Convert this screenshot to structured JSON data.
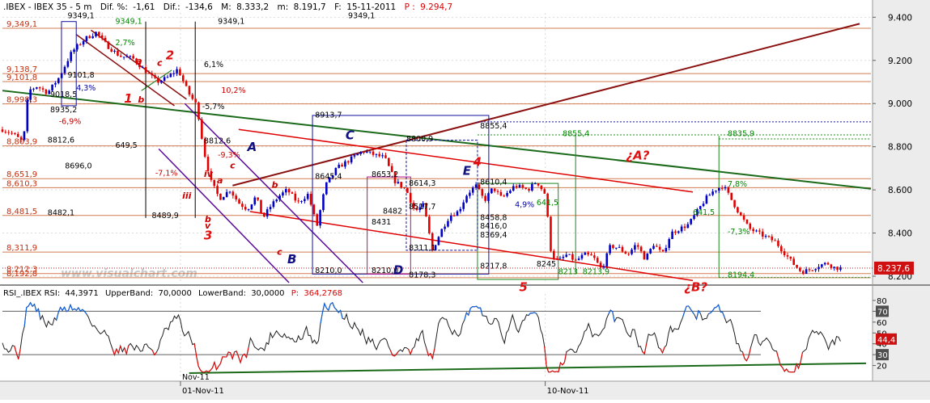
{
  "header": {
    "symbol": ".IBEX - IBEX 35 - 5 m",
    "dif_pct_label": "Dif. %:",
    "dif_pct": "-1,61",
    "dif_label": "Dif.:",
    "dif": "-134,6",
    "max_label": "M:",
    "max": "8.333,2",
    "min_label": "m:",
    "min": "8.191,7",
    "date_label": "F:",
    "date": "15-11-2011",
    "price_label": "P :",
    "price": "9.294,7"
  },
  "watermark": "www.visualchart.com",
  "colors": {
    "up": "#0000c8",
    "down": "#e00000",
    "wave": "#e01010",
    "wave_blue": "#101080",
    "fib": "#cc6633",
    "trend_main": "#1a6a1a",
    "trend_up": "#8b1010",
    "channel": "#5a0a9a",
    "rsi_line": "#202020",
    "rsi_level": "#606060",
    "price_badge": "#d01010"
  },
  "rsi_header": {
    "label": "RSI_.IBEX RSI:",
    "value": "44,3971",
    "upper_label": "UpperBand:",
    "upper": "70,0000",
    "lower_label": "LowerBand:",
    "lower": "30,0000",
    "p_label": "P:",
    "p": "364,2768"
  },
  "chart_data": [
    {
      "type": "candlestick",
      "series": [
        {
          "name": "IBEX 35 - 5 m"
        }
      ],
      "ylim": [
        8170,
        9420
      ],
      "y_ticks": [
        8200,
        8400,
        8600,
        8800,
        9000,
        9200,
        9400
      ],
      "y_tick_labels": [
        "8.200",
        "8.400",
        "8.600",
        "8.800",
        "9.000",
        "9.200",
        "9.400"
      ],
      "x_labels": [
        {
          "label": "01-Nov-11",
          "pos": 0.205
        },
        {
          "label": "10-Nov-11",
          "pos": 0.625
        }
      ],
      "last_price": 8237.6,
      "last_price_label": "8.237,6",
      "path": [
        [
          0.0,
          8880
        ],
        [
          0.012,
          8860
        ],
        [
          0.024,
          8820
        ],
        [
          0.03,
          9060
        ],
        [
          0.04,
          9080
        ],
        [
          0.052,
          9050
        ],
        [
          0.065,
          9120
        ],
        [
          0.08,
          9240
        ],
        [
          0.095,
          9300
        ],
        [
          0.108,
          9330
        ],
        [
          0.12,
          9270
        ],
        [
          0.135,
          9220
        ],
        [
          0.15,
          9210
        ],
        [
          0.165,
          9150
        ],
        [
          0.178,
          9100
        ],
        [
          0.19,
          9120
        ],
        [
          0.202,
          9160
        ],
        [
          0.214,
          9050
        ],
        [
          0.224,
          8990
        ],
        [
          0.232,
          8780
        ],
        [
          0.24,
          8640
        ],
        [
          0.25,
          8560
        ],
        [
          0.262,
          8600
        ],
        [
          0.272,
          8540
        ],
        [
          0.282,
          8510
        ],
        [
          0.292,
          8570
        ],
        [
          0.3,
          8470
        ],
        [
          0.308,
          8520
        ],
        [
          0.318,
          8570
        ],
        [
          0.328,
          8600
        ],
        [
          0.34,
          8540
        ],
        [
          0.352,
          8580
        ],
        [
          0.362,
          8430
        ],
        [
          0.372,
          8620
        ],
        [
          0.385,
          8700
        ],
        [
          0.4,
          8740
        ],
        [
          0.415,
          8780
        ],
        [
          0.43,
          8760
        ],
        [
          0.44,
          8750
        ],
        [
          0.452,
          8640
        ],
        [
          0.465,
          8600
        ],
        [
          0.475,
          8500
        ],
        [
          0.485,
          8530
        ],
        [
          0.495,
          8320
        ],
        [
          0.505,
          8410
        ],
        [
          0.515,
          8480
        ],
        [
          0.525,
          8500
        ],
        [
          0.535,
          8580
        ],
        [
          0.545,
          8620
        ],
        [
          0.555,
          8550
        ],
        [
          0.565,
          8610
        ],
        [
          0.575,
          8560
        ],
        [
          0.59,
          8620
        ],
        [
          0.605,
          8600
        ],
        [
          0.615,
          8640
        ],
        [
          0.625,
          8580
        ],
        [
          0.632,
          8300
        ],
        [
          0.64,
          8270
        ],
        [
          0.65,
          8300
        ],
        [
          0.66,
          8270
        ],
        [
          0.67,
          8300
        ],
        [
          0.68,
          8290
        ],
        [
          0.69,
          8230
        ],
        [
          0.7,
          8340
        ],
        [
          0.71,
          8330
        ],
        [
          0.72,
          8300
        ],
        [
          0.73,
          8350
        ],
        [
          0.74,
          8280
        ],
        [
          0.75,
          8350
        ],
        [
          0.76,
          8300
        ],
        [
          0.77,
          8400
        ],
        [
          0.78,
          8420
        ],
        [
          0.79,
          8440
        ],
        [
          0.8,
          8500
        ],
        [
          0.81,
          8560
        ],
        [
          0.82,
          8600
        ],
        [
          0.83,
          8620
        ],
        [
          0.84,
          8550
        ],
        [
          0.85,
          8480
        ],
        [
          0.86,
          8420
        ],
        [
          0.87,
          8400
        ],
        [
          0.88,
          8380
        ],
        [
          0.89,
          8360
        ],
        [
          0.9,
          8310
        ],
        [
          0.91,
          8260
        ],
        [
          0.92,
          8220
        ],
        [
          0.93,
          8230
        ],
        [
          0.94,
          8250
        ],
        [
          0.95,
          8260
        ],
        [
          0.958,
          8240
        ],
        [
          0.965,
          8237.6
        ]
      ],
      "levels": [
        {
          "label": "9,349,1",
          "value": 9349.1
        },
        {
          "label": "9,138,7",
          "value": 9138.7
        },
        {
          "label": "9,101,8",
          "value": 9101.8
        },
        {
          "label": "8,998,3",
          "value": 8998.3
        },
        {
          "label": "8,803,9",
          "value": 8803.9
        },
        {
          "label": "8,651,9",
          "value": 8651.9
        },
        {
          "label": "8,610,3",
          "value": 8610.3
        },
        {
          "label": "8,481,5",
          "value": 8481.5
        },
        {
          "label": "8,311,9",
          "value": 8311.9
        },
        {
          "label": "8,212,3",
          "value": 8212.3
        },
        {
          "label": "8,192,8",
          "value": 8192.8
        }
      ],
      "annotations": [
        {
          "text": "9349,1",
          "pos": 0.075,
          "value": 9395,
          "color": "#000000"
        },
        {
          "text": "9349,1",
          "pos": 0.398,
          "value": 9395,
          "color": "#000000"
        },
        {
          "text": "9349,1",
          "pos": 0.248,
          "value": 9370,
          "color": "#000000"
        },
        {
          "text": "9349,1",
          "pos": 0.13,
          "value": 9370,
          "color": "#008800"
        },
        {
          "text": "2,7%",
          "pos": 0.13,
          "value": 9270,
          "color": "#008800"
        },
        {
          "text": "9101,8",
          "pos": 0.075,
          "value": 9120,
          "color": "#000000"
        },
        {
          "text": "9018,5",
          "pos": 0.055,
          "value": 9030,
          "color": "#000000"
        },
        {
          "text": "4,3%",
          "pos": 0.085,
          "value": 9060,
          "color": "#0000aa"
        },
        {
          "text": "8935,2",
          "pos": 0.055,
          "value": 8960,
          "color": "#000000"
        },
        {
          "text": "-6,9%",
          "pos": 0.065,
          "value": 8905,
          "color": "#cc0000"
        },
        {
          "text": "8812,6",
          "pos": 0.052,
          "value": 8820,
          "color": "#000000"
        },
        {
          "text": "8696,0",
          "pos": 0.072,
          "value": 8700,
          "color": "#000000"
        },
        {
          "text": "8482,1",
          "pos": 0.052,
          "value": 8482,
          "color": "#000000"
        },
        {
          "text": "6,1%",
          "pos": 0.232,
          "value": 9170,
          "color": "#000000"
        },
        {
          "text": "10,2%",
          "pos": 0.252,
          "value": 9050,
          "color": "#cc0000"
        },
        {
          "text": "-5,7%",
          "pos": 0.23,
          "value": 8975,
          "color": "#000000"
        },
        {
          "text": "-9,3%",
          "pos": 0.248,
          "value": 8750,
          "color": "#cc0000"
        },
        {
          "text": "-7,1%",
          "pos": 0.176,
          "value": 8665,
          "color": "#cc0000"
        },
        {
          "text": "8812,6",
          "pos": 0.232,
          "value": 8815,
          "color": "#000000"
        },
        {
          "text": "649,5",
          "pos": 0.13,
          "value": 8795,
          "color": "#000000"
        },
        {
          "text": "8489,9",
          "pos": 0.172,
          "value": 8470,
          "color": "#000000"
        },
        {
          "text": "8913,7",
          "pos": 0.36,
          "value": 8935,
          "color": "#000000"
        },
        {
          "text": "8645,4",
          "pos": 0.36,
          "value": 8650,
          "color": "#000000"
        },
        {
          "text": "8653,2",
          "pos": 0.425,
          "value": 8660,
          "color": "#000000"
        },
        {
          "text": "8800,9",
          "pos": 0.465,
          "value": 8825,
          "color": "#000000"
        },
        {
          "text": "8614,3",
          "pos": 0.468,
          "value": 8620,
          "color": "#000000"
        },
        {
          "text": "8517,7",
          "pos": 0.468,
          "value": 8510,
          "color": "#000000"
        },
        {
          "text": "8482",
          "pos": 0.438,
          "value": 8490,
          "color": "#000000"
        },
        {
          "text": "8431",
          "pos": 0.425,
          "value": 8440,
          "color": "#000000"
        },
        {
          "text": "8311,1",
          "pos": 0.468,
          "value": 8320,
          "color": "#000000"
        },
        {
          "text": "8210,0",
          "pos": 0.36,
          "value": 8215,
          "color": "#000000"
        },
        {
          "text": "8210,0",
          "pos": 0.425,
          "value": 8215,
          "color": "#000000"
        },
        {
          "text": "8178,3",
          "pos": 0.468,
          "value": 8195,
          "color": "#000000"
        },
        {
          "text": "8855,4",
          "pos": 0.55,
          "value": 8885,
          "color": "#000000"
        },
        {
          "text": "8855,4",
          "pos": 0.645,
          "value": 8850,
          "color": "#008800"
        },
        {
          "text": "8610,4",
          "pos": 0.55,
          "value": 8625,
          "color": "#000000"
        },
        {
          "text": "8458,8",
          "pos": 0.55,
          "value": 8460,
          "color": "#000000"
        },
        {
          "text": "8416,0",
          "pos": 0.55,
          "value": 8420,
          "color": "#000000"
        },
        {
          "text": "8369,4",
          "pos": 0.55,
          "value": 8380,
          "color": "#000000"
        },
        {
          "text": "8217,8",
          "pos": 0.55,
          "value": 8235,
          "color": "#000000"
        },
        {
          "text": "641,5",
          "pos": 0.615,
          "value": 8530,
          "color": "#008800"
        },
        {
          "text": "4,9%",
          "pos": 0.59,
          "value": 8520,
          "color": "#0000aa"
        },
        {
          "text": "8245",
          "pos": 0.615,
          "value": 8245,
          "color": "#000000"
        },
        {
          "text": "8213",
          "pos": 0.64,
          "value": 8210,
          "color": "#008800"
        },
        {
          "text": "8213,9",
          "pos": 0.668,
          "value": 8210,
          "color": "#008800"
        },
        {
          "text": "8835,9",
          "pos": 0.835,
          "value": 8850,
          "color": "#008800"
        },
        {
          "text": "7,8%",
          "pos": 0.835,
          "value": 8615,
          "color": "#008800"
        },
        {
          "text": "641,5",
          "pos": 0.795,
          "value": 8485,
          "color": "#008800"
        },
        {
          "text": "-7,3%",
          "pos": 0.835,
          "value": 8395,
          "color": "#008800"
        },
        {
          "text": "8194,4",
          "pos": 0.835,
          "value": 8195,
          "color": "#008800"
        }
      ],
      "wave_labels": [
        {
          "text": "1",
          "pos": 0.14,
          "value": 9005,
          "color": "#e01010"
        },
        {
          "text": "2",
          "pos": 0.188,
          "value": 9205,
          "color": "#e01010"
        },
        {
          "text": "3",
          "pos": 0.232,
          "value": 8370,
          "color": "#e01010"
        },
        {
          "text": "4",
          "pos": 0.542,
          "value": 8710,
          "color": "#e01010"
        },
        {
          "text": "5",
          "pos": 0.595,
          "value": 8130,
          "color": "#e01010"
        },
        {
          "text": "¿A?",
          "pos": 0.718,
          "value": 8740,
          "color": "#e01010"
        },
        {
          "text": "¿B?",
          "pos": 0.785,
          "value": 8130,
          "color": "#e01010"
        },
        {
          "text": "A",
          "pos": 0.282,
          "value": 8780,
          "color": "#101080"
        },
        {
          "text": "B",
          "pos": 0.328,
          "value": 8260,
          "color": "#101080"
        },
        {
          "text": "C",
          "pos": 0.395,
          "value": 8835,
          "color": "#101080"
        },
        {
          "text": "D",
          "pos": 0.45,
          "value": 8210,
          "color": "#101080"
        },
        {
          "text": "E",
          "pos": 0.53,
          "value": 8670,
          "color": "#101080"
        },
        {
          "text": "a",
          "pos": 0.154,
          "value": 9185,
          "color": "#cc0000"
        },
        {
          "text": "b",
          "pos": 0.156,
          "value": 9005,
          "color": "#cc0000"
        },
        {
          "text": "c",
          "pos": 0.178,
          "value": 9175,
          "color": "#cc0000"
        },
        {
          "text": "a",
          "pos": 0.247,
          "value": 8630,
          "color": "#cc0000"
        },
        {
          "text": "b",
          "pos": 0.233,
          "value": 8450,
          "color": "#cc0000"
        },
        {
          "text": "c",
          "pos": 0.262,
          "value": 8700,
          "color": "#cc0000"
        },
        {
          "text": "b",
          "pos": 0.31,
          "value": 8610,
          "color": "#cc0000"
        },
        {
          "text": "c",
          "pos": 0.316,
          "value": 8300,
          "color": "#cc0000"
        },
        {
          "text": "iii",
          "pos": 0.207,
          "value": 8560,
          "color": "#cc0000"
        },
        {
          "text": "iv",
          "pos": 0.232,
          "value": 8660,
          "color": "#cc0000"
        },
        {
          "text": "v",
          "pos": 0.233,
          "value": 8420,
          "color": "#cc0000"
        }
      ]
    },
    {
      "type": "line",
      "series": [
        {
          "name": "RSI_.IBEX RSI"
        }
      ],
      "ylim": [
        10,
        80
      ],
      "y_ticks": [
        20,
        30,
        40,
        50,
        60,
        70,
        80
      ],
      "y_tick_labels": [
        "20",
        "30",
        "40",
        "50",
        "60",
        "70",
        "80"
      ],
      "bands": [
        70,
        30
      ],
      "badges": [
        {
          "label": "70",
          "value": 70
        },
        {
          "label": "44,4",
          "value": 44.4
        },
        {
          "label": "30",
          "value": 30
        }
      ],
      "axis_note": "Nov-11"
    }
  ]
}
